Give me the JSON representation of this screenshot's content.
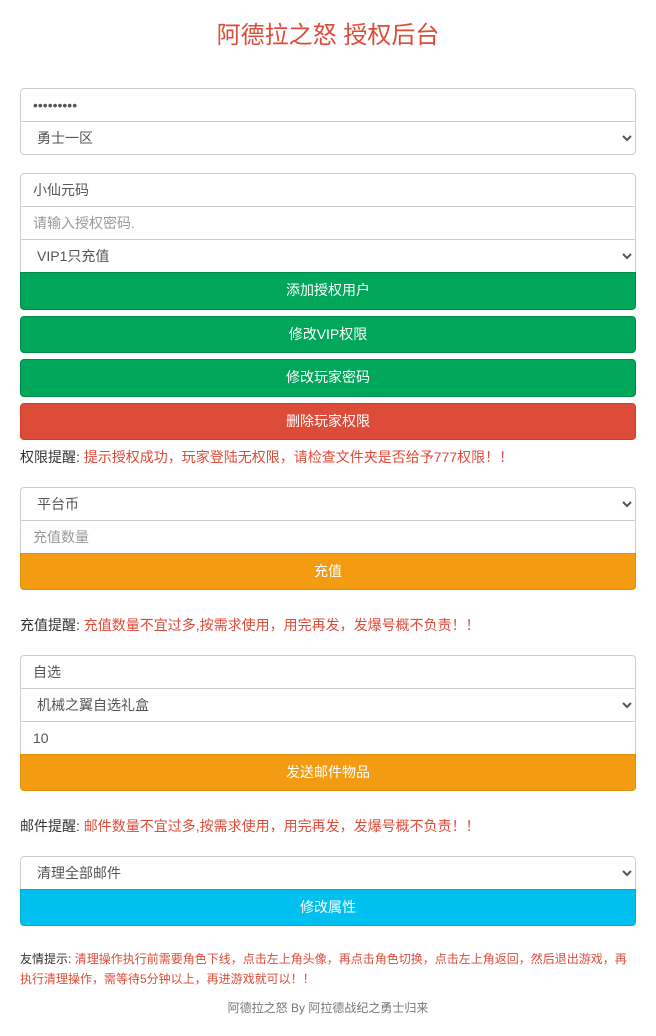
{
  "title": "阿德拉之怒 授权后台",
  "login": {
    "password_value": "•••••••••",
    "server_selected": "勇士一区"
  },
  "auth": {
    "user_value": "小仙元码",
    "auth_code_placeholder": "请输入授权密码.",
    "vip_selected": "VIP1只充值",
    "btn_add": "添加授权用户",
    "btn_modify_vip": "修改VIP权限",
    "btn_modify_pwd": "修改玩家密码",
    "btn_delete": "删除玩家权限",
    "hint_label": "权限提醒:",
    "hint_text": "提示授权成功，玩家登陆无权限，请检查文件夹是否给予777权限！！"
  },
  "recharge": {
    "currency_selected": "平台币",
    "amount_placeholder": "充值数量",
    "btn_label": "充值",
    "hint_label": "充值提醒:",
    "hint_text": "充值数量不宜过多,按需求使用，用完再发，发爆号概不负责！！"
  },
  "mail": {
    "type_value": "自选",
    "item_selected": "机械之翼自选礼盒",
    "qty_value": "10",
    "btn_label": "发送邮件物品",
    "hint_label": "邮件提醒:",
    "hint_text": "邮件数量不宜过多,按需求使用，用完再发，发爆号概不负责！！"
  },
  "tools": {
    "action_selected": "清理全部邮件",
    "btn_label": "修改属性",
    "hint_label": "友情提示:",
    "hint_text": "清理操作执行前需要角色下线，点击左上角头像，再点击角色切换，点击左上角返回，然后退出游戏，再执行清理操作，需等待5分钟以上，再进游戏就可以！！"
  },
  "footer": "阿德拉之怒 By 阿拉德战纪之勇士归来"
}
